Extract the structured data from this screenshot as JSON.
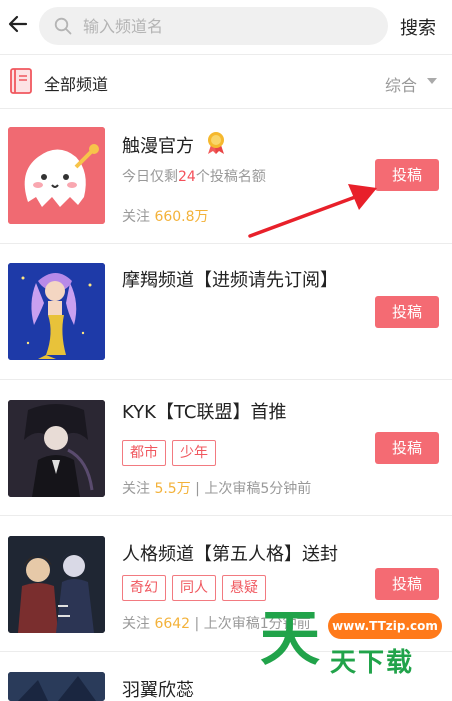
{
  "header": {
    "search_placeholder": "输入频道名",
    "search_button": "搜索"
  },
  "filter": {
    "title": "全部频道",
    "sort_label": "综合"
  },
  "channels": [
    {
      "name": "触漫官方",
      "quota_prefix": "今日仅剩",
      "quota_count": "24",
      "quota_suffix": "个投稿名额",
      "stats_label": "关注",
      "stats_value": "660.8万",
      "submit_label": "投稿"
    },
    {
      "name": "摩羯频道【进频请先订阅】",
      "submit_label": "投稿"
    },
    {
      "name": "KYK【TC联盟】首推",
      "tags": [
        "都市",
        "少年"
      ],
      "stats_label": "关注",
      "stats_value": "5.5万",
      "stats_suffix": "| 上次审稿5分钟前",
      "submit_label": "投稿"
    },
    {
      "name": "人格频道【第五人格】送封",
      "tags": [
        "奇幻",
        "同人",
        "悬疑"
      ],
      "stats_label": "关注",
      "stats_value": "6642",
      "stats_suffix": "| 上次审稿1分钟前",
      "submit_label": "投稿"
    },
    {
      "name": "羽翼欣蕊"
    }
  ],
  "watermark": {
    "url": "www.TTzip.com",
    "big": "天",
    "text": "天下载"
  },
  "colors": {
    "accent": "#f46b73",
    "highlight_red": "#f4505a",
    "highlight_orange": "#f3b23a",
    "arrow_red": "#e8202a",
    "watermark_green": "#21a34a",
    "watermark_orange": "#ff7a1a"
  }
}
